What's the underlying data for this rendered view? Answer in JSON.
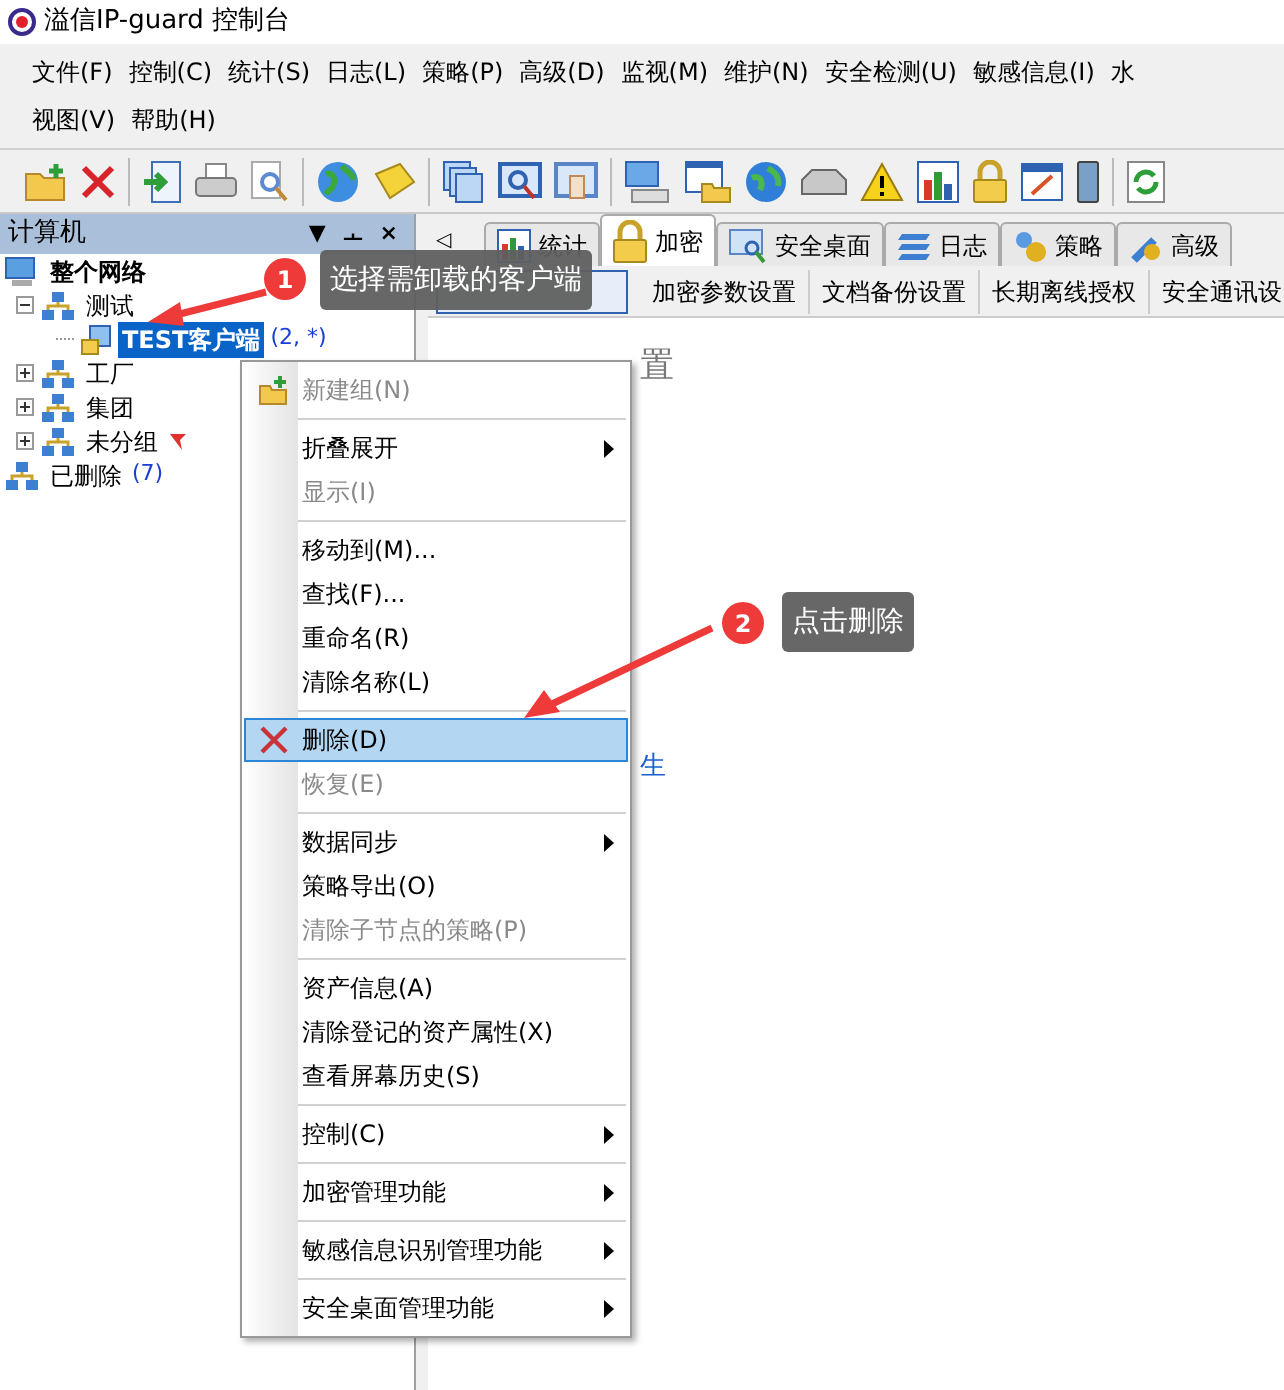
{
  "window": {
    "title": "溢信IP-guard 控制台"
  },
  "menu_bar": [
    {
      "label": "文件(F)"
    },
    {
      "label": "控制(C)"
    },
    {
      "label": "统计(S)"
    },
    {
      "label": "日志(L)"
    },
    {
      "label": "策略(P)"
    },
    {
      "label": "高级(D)"
    },
    {
      "label": "监视(M)"
    },
    {
      "label": "维护(N)"
    },
    {
      "label": "安全检测(U)"
    },
    {
      "label": "敏感信息(I)"
    },
    {
      "label": "水"
    },
    {
      "label": "视图(V)"
    },
    {
      "label": "帮助(H)"
    }
  ],
  "left_pane": {
    "title": "计算机",
    "controls": [
      "▼",
      "ㅗ",
      "×"
    ],
    "tree": [
      {
        "label": "整个网络",
        "kind": "network",
        "expanded": true,
        "selected": false,
        "children": [
          {
            "label": "测试",
            "kind": "group",
            "expanded": true,
            "selected": false,
            "children": [
              {
                "label": "TEST客户端",
                "count": "(2, *)",
                "kind": "client",
                "selected": true
              }
            ]
          },
          {
            "label": "工厂",
            "kind": "group",
            "expanded": false,
            "selected": false
          },
          {
            "label": "集团",
            "kind": "group",
            "expanded": false,
            "selected": false
          },
          {
            "label": "未分组",
            "kind": "group",
            "expanded": false,
            "selected": false,
            "flag": true
          }
        ]
      },
      {
        "label": "已删除",
        "count": "(7)",
        "kind": "deleted",
        "selected": false
      }
    ]
  },
  "tabs": {
    "scroll": "◁",
    "items": [
      {
        "label": "统计",
        "selected": false
      },
      {
        "label": "加密",
        "selected": true
      },
      {
        "label": "安全桌面",
        "selected": false
      },
      {
        "label": "日志",
        "selected": false
      },
      {
        "label": "策略",
        "selected": false
      },
      {
        "label": "高级",
        "selected": false
      }
    ]
  },
  "sub_tabs": [
    {
      "selected": true
    },
    {
      "label": "加密参数设置",
      "selected": false
    },
    {
      "label": "文档备份设置",
      "selected": false
    },
    {
      "label": "长期离线授权",
      "selected": false
    },
    {
      "label": "安全通讯设",
      "selected": false
    }
  ],
  "content": {
    "heading_tail": "置",
    "link_tail": "生"
  },
  "context_menu": [
    {
      "kind": "item",
      "label": "新建组(N)",
      "disabled": true,
      "submenu": false,
      "selected": false
    },
    {
      "kind": "separator"
    },
    {
      "kind": "item",
      "label": "折叠展开",
      "disabled": false,
      "submenu": true,
      "selected": false
    },
    {
      "kind": "item",
      "label": "显示(I)",
      "disabled": true,
      "submenu": false,
      "selected": false
    },
    {
      "kind": "separator"
    },
    {
      "kind": "item",
      "label": "移动到(M)...",
      "disabled": false,
      "submenu": false,
      "selected": false
    },
    {
      "kind": "item",
      "label": "查找(F)...",
      "disabled": false,
      "submenu": false,
      "selected": false
    },
    {
      "kind": "item",
      "label": "重命名(R)",
      "disabled": false,
      "submenu": false,
      "selected": false
    },
    {
      "kind": "item",
      "label": "清除名称(L)",
      "disabled": false,
      "submenu": false,
      "selected": false
    },
    {
      "kind": "separator"
    },
    {
      "kind": "item",
      "label": "删除(D)",
      "disabled": false,
      "submenu": false,
      "selected": true
    },
    {
      "kind": "item",
      "label": "恢复(E)",
      "disabled": true,
      "submenu": false,
      "selected": false
    },
    {
      "kind": "separator"
    },
    {
      "kind": "item",
      "label": "数据同步",
      "disabled": false,
      "submenu": true,
      "selected": false
    },
    {
      "kind": "item",
      "label": "策略导出(O)",
      "disabled": false,
      "submenu": false,
      "selected": false
    },
    {
      "kind": "item",
      "label": "清除子节点的策略(P)",
      "disabled": true,
      "submenu": false,
      "selected": false
    },
    {
      "kind": "separator"
    },
    {
      "kind": "item",
      "label": "资产信息(A)",
      "disabled": false,
      "submenu": false,
      "selected": false
    },
    {
      "kind": "item",
      "label": "清除登记的资产属性(X)",
      "disabled": false,
      "submenu": false,
      "selected": false
    },
    {
      "kind": "item",
      "label": "查看屏幕历史(S)",
      "disabled": false,
      "submenu": false,
      "selected": false
    },
    {
      "kind": "separator"
    },
    {
      "kind": "item",
      "label": "控制(C)",
      "disabled": false,
      "submenu": true,
      "selected": false
    },
    {
      "kind": "separator"
    },
    {
      "kind": "item",
      "label": "加密管理功能",
      "disabled": false,
      "submenu": true,
      "selected": false
    },
    {
      "kind": "separator"
    },
    {
      "kind": "item",
      "label": "敏感信息识别管理功能",
      "disabled": false,
      "submenu": true,
      "selected": false
    },
    {
      "kind": "separator"
    },
    {
      "kind": "item",
      "label": "安全桌面管理功能",
      "disabled": false,
      "submenu": true,
      "selected": false
    }
  ],
  "annotations": [
    {
      "number": "1",
      "text": "选择需卸载的客户端"
    },
    {
      "number": "2",
      "text": "点击删除"
    }
  ]
}
